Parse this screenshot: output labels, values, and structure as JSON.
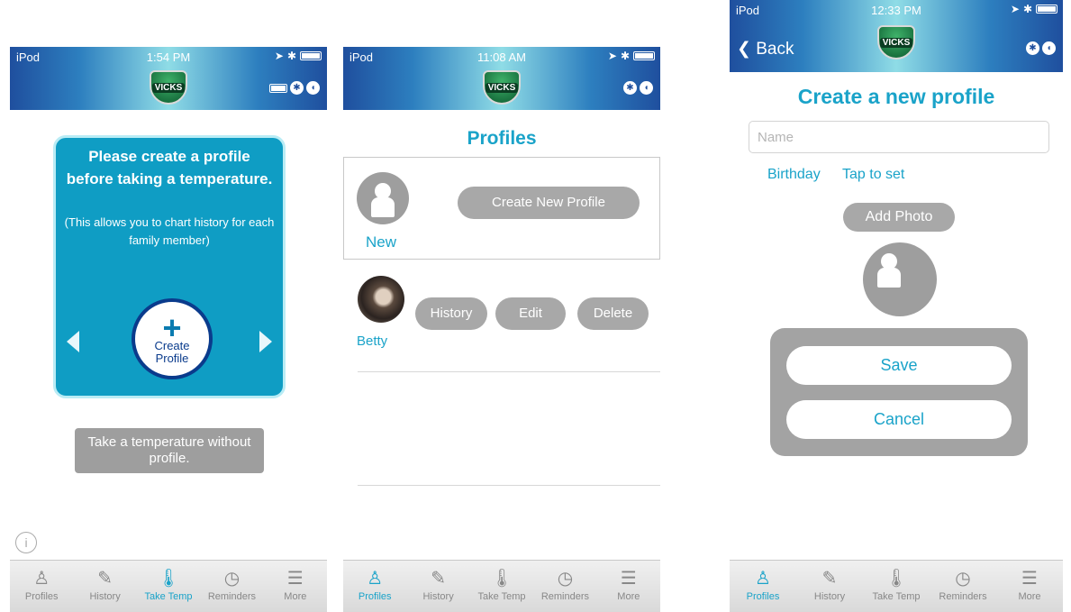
{
  "screen1": {
    "status": {
      "carrier": "iPod",
      "time": "1:54 PM"
    },
    "logo_text": "VICKS",
    "prompt": {
      "message": "Please create a profile before taking a temperature.",
      "note": "(This allows you to chart history for each family member)"
    },
    "create_button": {
      "line1": "Create",
      "line2": "Profile"
    },
    "no_profile_button": "Take a temperature without profile.",
    "tabs": [
      {
        "label": "Profiles",
        "icon": "person-icon"
      },
      {
        "label": "History",
        "icon": "notepad-icon"
      },
      {
        "label": "Take Temp",
        "icon": "thermometer-icon"
      },
      {
        "label": "Reminders",
        "icon": "clock-icon"
      },
      {
        "label": "More",
        "icon": "menu-icon"
      }
    ],
    "active_tab": "Take Temp"
  },
  "screen2": {
    "status": {
      "carrier": "iPod",
      "time": "11:08 AM"
    },
    "logo_text": "VICKS",
    "title": "Profiles",
    "new_profile": {
      "name": "New",
      "button": "Create New Profile"
    },
    "profiles": [
      {
        "name": "Betty",
        "actions": [
          "History",
          "Edit",
          "Delete"
        ]
      }
    ],
    "tabs": [
      {
        "label": "Profiles",
        "icon": "person-icon"
      },
      {
        "label": "History",
        "icon": "notepad-icon"
      },
      {
        "label": "Take Temp",
        "icon": "thermometer-icon"
      },
      {
        "label": "Reminders",
        "icon": "clock-icon"
      },
      {
        "label": "More",
        "icon": "menu-icon"
      }
    ],
    "active_tab": "Profiles"
  },
  "screen3": {
    "status": {
      "carrier": "iPod",
      "time": "12:33 PM"
    },
    "logo_text": "VICKS",
    "back": "Back",
    "title": "Create a new profile",
    "name_placeholder": "Name",
    "birthday_label": "Birthday",
    "birthday_value": "Tap to set",
    "add_photo": "Add Photo",
    "save": "Save",
    "cancel": "Cancel",
    "tabs": [
      {
        "label": "Profiles",
        "icon": "person-icon"
      },
      {
        "label": "History",
        "icon": "notepad-icon"
      },
      {
        "label": "Take Temp",
        "icon": "thermometer-icon"
      },
      {
        "label": "Reminders",
        "icon": "clock-icon"
      },
      {
        "label": "More",
        "icon": "menu-icon"
      }
    ],
    "active_tab": "Profiles"
  },
  "colors": {
    "accent": "#1aa3c9",
    "card": "#0f9dc4",
    "pill_gray": "#a8a8a8",
    "header_dark": "#1f4f9e"
  }
}
